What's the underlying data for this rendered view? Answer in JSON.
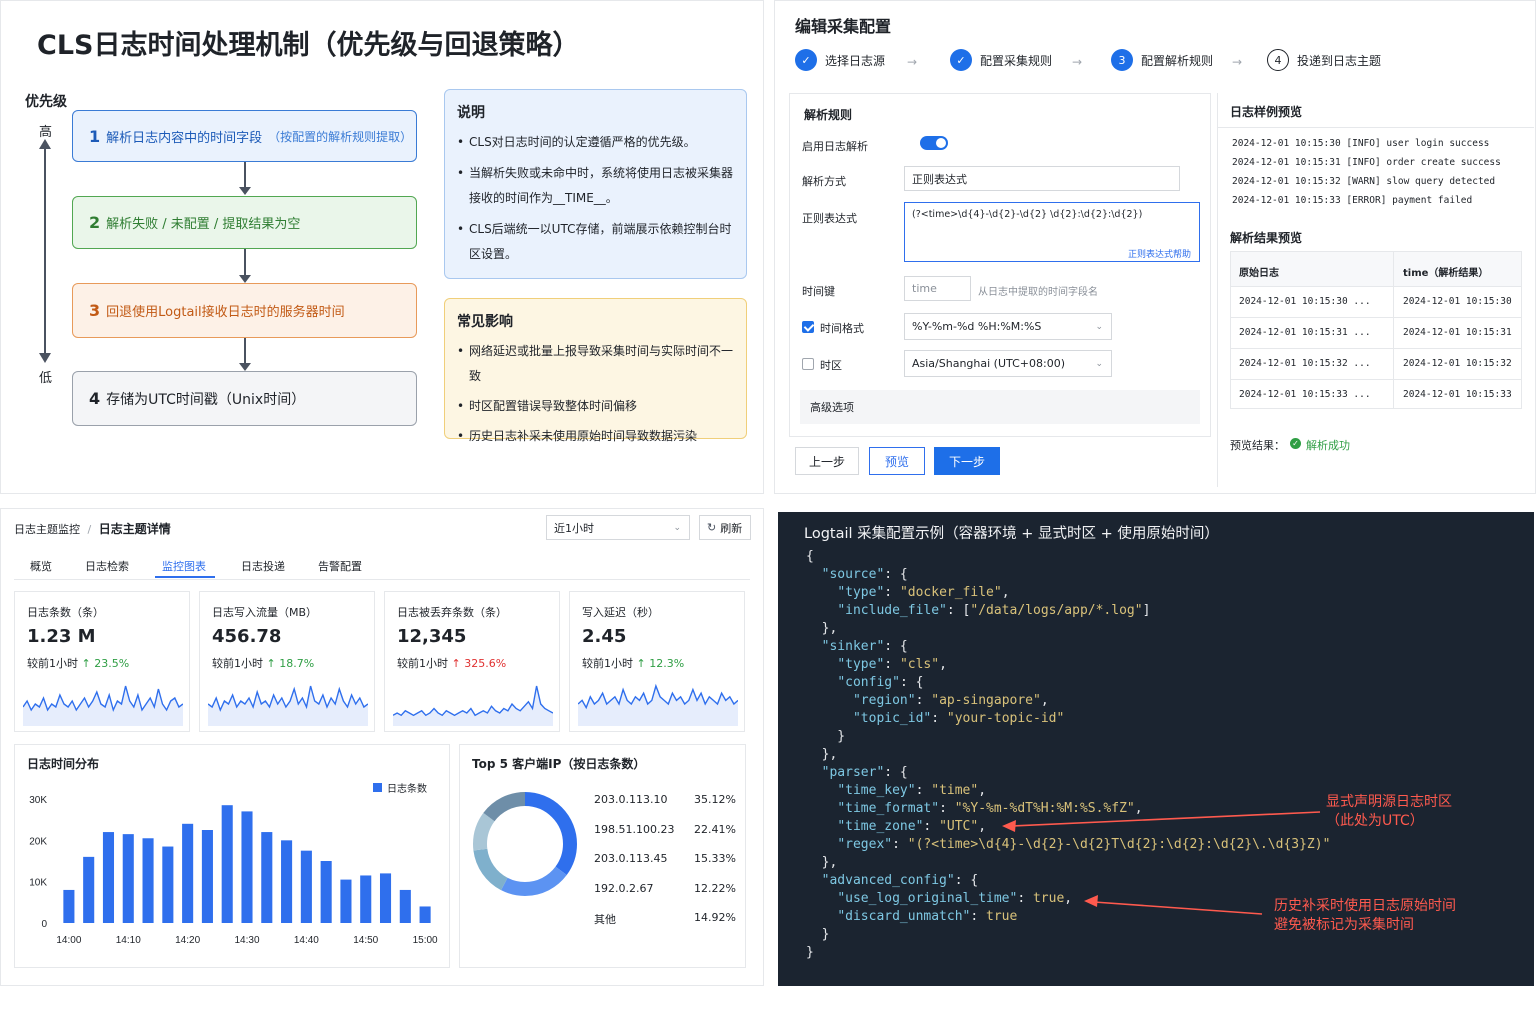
{
  "diagram": {
    "title": "CLS日志时间处理机制（优先级与回退策略）",
    "priority_label": "优先级",
    "axis_high": "高",
    "axis_low": "低",
    "steps": [
      {
        "num": "1",
        "text": "解析日志内容中的时间字段",
        "sub": "（按配置的解析规则提取）"
      },
      {
        "num": "2",
        "text": "解析失败 / 未配置 / 提取结果为空"
      },
      {
        "num": "3",
        "text": "回退使用Logtail接收日志时的服务器时间"
      },
      {
        "num": "4",
        "text": "存储为UTC时间戳（Unix时间）"
      }
    ],
    "note": {
      "title": "说明",
      "items": [
        "CLS对日志时间的认定遵循严格的优先级。",
        "当解析失败或未命中时，系统将使用日志被采集器接收的时间作为__TIME__。",
        "CLS后端统一以UTC存储，前端展示依赖控制台时区设置。"
      ]
    },
    "impact": {
      "title": "常见影响",
      "items": [
        "网络延迟或批量上报导致采集时间与实际时间不一致",
        "时区配置错误导致整体时间偏移",
        "历史日志补采未使用原始时间导致数据污染"
      ]
    }
  },
  "config": {
    "title": "编辑采集配置",
    "steps": [
      "选择日志源",
      "配置采集规则",
      "配置解析规则",
      "投递到日志主题"
    ],
    "step3_num": "3",
    "step4_num": "4",
    "section_title": "解析规则",
    "enable_label": "启用日志解析",
    "enable_on": true,
    "method_label": "解析方式",
    "method_value": "正则表达式",
    "regex_label": "正则表达式",
    "regex_value": "(?<time>\\d{4}-\\d{2}-\\d{2} \\d{2}:\\d{2}:\\d{2})",
    "regex_help": "正则表达式帮助",
    "timekey_label": "时间键",
    "timekey_placeholder": "time",
    "timekey_hint": "从日志中提取的时间字段名",
    "format_label": "时间格式",
    "format_checked": true,
    "format_value": "%Y-%m-%d %H:%M:%S",
    "tz_label": "时区",
    "tz_checked": false,
    "tz_value": "Asia/Shanghai (UTC+08:00)",
    "advanced_label": "高级选项",
    "btn_prev": "上一步",
    "btn_preview": "预览",
    "btn_next": "下一步",
    "sample_title": "日志样例预览",
    "samples": [
      "2024-12-01 10:15:30 [INFO] user login success",
      "2024-12-01 10:15:31 [INFO] order create success",
      "2024-12-01 10:15:32 [WARN] slow query detected",
      "2024-12-01 10:15:33 [ERROR] payment failed"
    ],
    "result_title": "解析结果预览",
    "result_headers": [
      "原始日志",
      "time（解析结果）"
    ],
    "result_rows": [
      [
        "2024-12-01 10:15:30 ...",
        "2024-12-01 10:15:30"
      ],
      [
        "2024-12-01 10:15:31 ...",
        "2024-12-01 10:15:31"
      ],
      [
        "2024-12-01 10:15:32 ...",
        "2024-12-01 10:15:32"
      ],
      [
        "2024-12-01 10:15:33 ...",
        "2024-12-01 10:15:33"
      ]
    ],
    "preview_label": "预览结果：",
    "preview_status": "解析成功"
  },
  "dashboard": {
    "breadcrumb_parent": "日志主题监控",
    "breadcrumb_sep": "/",
    "breadcrumb_current": "日志主题详情",
    "range": "近1小时",
    "refresh": "刷新",
    "tabs": [
      "概览",
      "日志检索",
      "监控图表",
      "日志投递",
      "告警配置"
    ],
    "active_tab": 2,
    "cards": [
      {
        "label": "日志条数（条）",
        "value": "1.23 M",
        "cmp": "较前1小时",
        "delta": "23.5%",
        "dir": "up",
        "good": true
      },
      {
        "label": "日志写入流量（MB）",
        "value": "456.78",
        "cmp": "较前1小时",
        "delta": "18.7%",
        "dir": "up",
        "good": true
      },
      {
        "label": "日志被丢弃条数（条）",
        "value": "12,345",
        "cmp": "较前1小时",
        "delta": "325.6%",
        "dir": "up",
        "good": false
      },
      {
        "label": "写入延迟（秒）",
        "value": "2.45",
        "cmp": "较前1小时",
        "delta": "12.3%",
        "dir": "up",
        "good": true
      }
    ],
    "spark": [
      [
        5,
        7,
        4,
        6,
        5,
        8,
        4,
        6,
        5,
        9,
        6,
        5,
        7,
        4,
        6,
        8,
        5,
        7,
        10,
        6,
        5,
        9,
        4,
        7,
        6,
        12,
        7,
        5,
        9,
        4,
        6,
        8,
        5,
        11,
        6,
        4,
        7,
        8,
        5,
        6
      ],
      [
        6,
        5,
        8,
        4,
        7,
        6,
        9,
        5,
        7,
        6,
        8,
        5,
        10,
        6,
        7,
        5,
        9,
        6,
        8,
        5,
        7,
        11,
        6,
        8,
        5,
        12,
        7,
        6,
        9,
        5,
        8,
        6,
        11,
        7,
        5,
        9,
        6,
        8,
        5,
        6
      ],
      [
        3,
        4,
        3,
        5,
        4,
        3,
        4,
        5,
        3,
        4,
        6,
        4,
        3,
        5,
        4,
        3,
        4,
        5,
        4,
        6,
        3,
        4,
        5,
        4,
        7,
        5,
        4,
        6,
        5,
        8,
        6,
        5,
        7,
        9,
        6,
        16,
        8,
        6,
        5,
        4
      ],
      [
        5,
        6,
        4,
        7,
        5,
        6,
        8,
        5,
        6,
        7,
        5,
        9,
        6,
        5,
        7,
        6,
        8,
        5,
        6,
        10,
        7,
        6,
        5,
        8,
        6,
        7,
        5,
        6,
        9,
        6,
        8,
        5,
        7,
        6,
        5,
        8,
        6,
        7,
        5,
        6
      ]
    ],
    "hist": {
      "title": "日志时间分布",
      "legend": "日志条数",
      "color": "#2f6fed",
      "chart_data": {
        "type": "bar",
        "title": "日志时间分布",
        "xlabel": "",
        "ylabel": "",
        "x_ticks": [
          "14:00",
          "14:10",
          "14:20",
          "14:30",
          "14:40",
          "14:50",
          "15:00"
        ],
        "y_ticks": [
          "0",
          "10K",
          "20K",
          "30K"
        ],
        "ylim": [
          0,
          30000
        ],
        "series": [
          {
            "name": "日志条数",
            "values": [
              8000,
              16000,
              22000,
              21500,
              20500,
              18500,
              24000,
              22500,
              28500,
              27000,
              22000,
              20000,
              17500,
              15000,
              10500,
              11500,
              12000,
              8000,
              4000
            ]
          }
        ]
      }
    },
    "top": {
      "title": "Top 5 客户端IP（按日志条数）",
      "chart_data": {
        "type": "pie",
        "labels": [
          "203.0.113.10",
          "198.51.100.23",
          "203.0.113.45",
          "192.0.2.67",
          "其他"
        ],
        "values": [
          35.12,
          22.41,
          15.33,
          12.22,
          14.92
        ],
        "value_labels": [
          "35.12%",
          "22.41%",
          "15.33%",
          "12.22%",
          "14.92%"
        ],
        "colors": [
          "#2f6fed",
          "#5c93f2",
          "#7fb0cc",
          "#a9c6d6",
          "#6e8ea8"
        ]
      }
    }
  },
  "code": {
    "title": "Logtail 采集配置示例（容器环境 + 显式时区 + 使用原始时间）",
    "lines": [
      [
        [
          "p",
          "{"
        ]
      ],
      [
        [
          "p",
          "  "
        ],
        [
          "k",
          "\"source\""
        ],
        [
          "p",
          ": {"
        ]
      ],
      [
        [
          "p",
          "    "
        ],
        [
          "k",
          "\"type\""
        ],
        [
          "p",
          ": "
        ],
        [
          "s",
          "\"docker_file\""
        ],
        [
          "p",
          ","
        ]
      ],
      [
        [
          "p",
          "    "
        ],
        [
          "k",
          "\"include_file\""
        ],
        [
          "p",
          ": ["
        ],
        [
          "s",
          "\"/data/logs/app/*.log\""
        ],
        [
          "p",
          "]"
        ]
      ],
      [
        [
          "p",
          "  },"
        ]
      ],
      [
        [
          "p",
          "  "
        ],
        [
          "k",
          "\"sinker\""
        ],
        [
          "p",
          ": {"
        ]
      ],
      [
        [
          "p",
          "    "
        ],
        [
          "k",
          "\"type\""
        ],
        [
          "p",
          ": "
        ],
        [
          "s",
          "\"cls\""
        ],
        [
          "p",
          ","
        ]
      ],
      [
        [
          "p",
          "    "
        ],
        [
          "k",
          "\"config\""
        ],
        [
          "p",
          ": {"
        ]
      ],
      [
        [
          "p",
          "      "
        ],
        [
          "k",
          "\"region\""
        ],
        [
          "p",
          ": "
        ],
        [
          "s",
          "\"ap-singapore\""
        ],
        [
          "p",
          ","
        ]
      ],
      [
        [
          "p",
          "      "
        ],
        [
          "k",
          "\"topic_id\""
        ],
        [
          "p",
          ": "
        ],
        [
          "s",
          "\"your-topic-id\""
        ]
      ],
      [
        [
          "p",
          "    }"
        ]
      ],
      [
        [
          "p",
          "  },"
        ]
      ],
      [
        [
          "p",
          "  "
        ],
        [
          "k",
          "\"parser\""
        ],
        [
          "p",
          ": {"
        ]
      ],
      [
        [
          "p",
          "    "
        ],
        [
          "k",
          "\"time_key\""
        ],
        [
          "p",
          ": "
        ],
        [
          "s",
          "\"time\""
        ],
        [
          "p",
          ","
        ]
      ],
      [
        [
          "p",
          "    "
        ],
        [
          "k",
          "\"time_format\""
        ],
        [
          "p",
          ": "
        ],
        [
          "s",
          "\"%Y-%m-%dT%H:%M:%S.%fZ\""
        ],
        [
          "p",
          ","
        ]
      ],
      [
        [
          "p",
          "    "
        ],
        [
          "k",
          "\"time_zone\""
        ],
        [
          "p",
          ": "
        ],
        [
          "s",
          "\"UTC\""
        ],
        [
          "p",
          ","
        ]
      ],
      [
        [
          "p",
          "    "
        ],
        [
          "k",
          "\"regex\""
        ],
        [
          "p",
          ": "
        ],
        [
          "s",
          "\"(?<time>\\d{4}-\\d{2}-\\d{2}T\\d{2}:\\d{2}:\\d{2}\\.\\d{3}Z)\""
        ]
      ],
      [
        [
          "p",
          "  },"
        ]
      ],
      [
        [
          "p",
          "  "
        ],
        [
          "k",
          "\"advanced_config\""
        ],
        [
          "p",
          ": {"
        ]
      ],
      [
        [
          "p",
          "    "
        ],
        [
          "k",
          "\"use_log_original_time\""
        ],
        [
          "p",
          ": "
        ],
        [
          "b",
          "true"
        ],
        [
          "p",
          ","
        ]
      ],
      [
        [
          "p",
          "    "
        ],
        [
          "k",
          "\"discard_unmatch\""
        ],
        [
          "p",
          ": "
        ],
        [
          "b",
          "true"
        ]
      ],
      [
        [
          "p",
          "  }"
        ]
      ],
      [
        [
          "p",
          "}"
        ]
      ]
    ],
    "anno1": [
      "显式声明源日志时区",
      "（此处为UTC）"
    ],
    "anno2": [
      "历史补采时使用日志原始时间",
      "避免被标记为采集时间"
    ],
    "anno_color": "#ff5a4e"
  }
}
